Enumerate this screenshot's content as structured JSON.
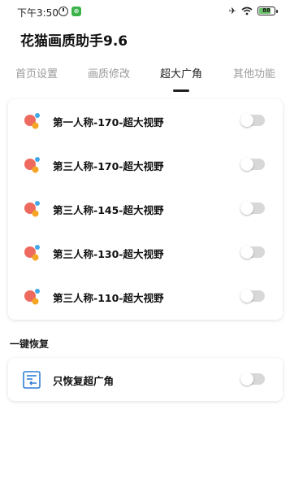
{
  "status_bar": {
    "time": "下午3:50",
    "battery": "88",
    "icons": [
      "alarm-icon",
      "app-notification-icon",
      "airplane-icon",
      "wifi-icon",
      "battery-icon"
    ]
  },
  "app": {
    "title": "花猫画质助手9.6"
  },
  "tabs": [
    {
      "label": "首页设置",
      "active": false
    },
    {
      "label": "画质修改",
      "active": false
    },
    {
      "label": "超大广角",
      "active": true
    },
    {
      "label": "其他功能",
      "active": false
    }
  ],
  "wide_angle_options": [
    {
      "label": "第一人称-170-超大视野",
      "icon": "bubbles-icon",
      "enabled": false
    },
    {
      "label": "第三人称-170-超大视野",
      "icon": "bubbles-icon",
      "enabled": false
    },
    {
      "label": "第三人称-145-超大视野",
      "icon": "bubbles-icon",
      "enabled": false
    },
    {
      "label": "第三人称-130-超大视野",
      "icon": "bubbles-icon",
      "enabled": false
    },
    {
      "label": "第三人称-110-超大视野",
      "icon": "bubbles-icon",
      "enabled": false
    }
  ],
  "restore_section": {
    "heading": "一键恢复",
    "option": {
      "label": "只恢复超广角",
      "icon": "restore-list-icon",
      "enabled": false
    }
  },
  "colors": {
    "bubble_red": "#ef6a5e",
    "bubble_blue": "#43a8e8",
    "bubble_orange": "#f5a524",
    "restore_icon_blue": "#2f7fd6",
    "toggle_off": "#d8d8d8"
  }
}
